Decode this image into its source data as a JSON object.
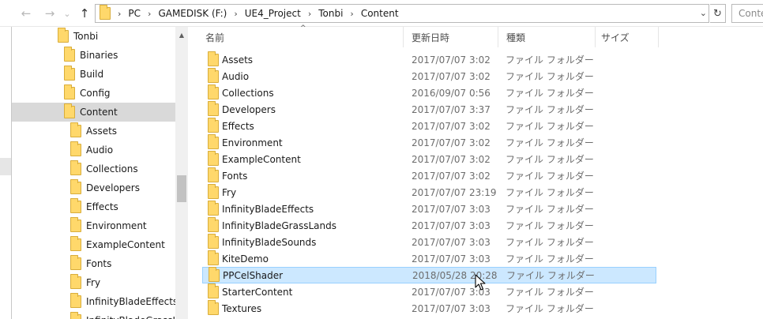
{
  "nav": {
    "back_glyph": "←",
    "forward_glyph": "→",
    "recent_glyph": "⌄",
    "up_glyph": "↑"
  },
  "address": {
    "crumbs": [
      "PC",
      "GAMEDISK (F:)",
      "UE4_Project",
      "Tonbi",
      "Content"
    ],
    "sep_glyph": "›",
    "dropdown_glyph": "⌄",
    "refresh_glyph": "↻"
  },
  "search": {
    "placeholder": "Conte"
  },
  "tree": {
    "items": [
      {
        "label": "Tonbi"
      },
      {
        "label": "Binaries"
      },
      {
        "label": "Build"
      },
      {
        "label": "Config"
      },
      {
        "label": "Content"
      },
      {
        "label": "Assets"
      },
      {
        "label": "Audio"
      },
      {
        "label": "Collections"
      },
      {
        "label": "Developers"
      },
      {
        "label": "Effects"
      },
      {
        "label": "Environment"
      },
      {
        "label": "ExampleContent"
      },
      {
        "label": "Fonts"
      },
      {
        "label": "Fry"
      },
      {
        "label": "InfinityBladeEffects"
      },
      {
        "label": "InfinityBladeGrassLands"
      }
    ],
    "selected_label": "Content"
  },
  "columns": {
    "name": "名前",
    "date": "更新日時",
    "type": "種類",
    "size": "サイズ",
    "sort_glyph": "^"
  },
  "files": [
    {
      "name": "Assets",
      "date": "2017/07/07 3:02",
      "type": "ファイル フォルダー"
    },
    {
      "name": "Audio",
      "date": "2017/07/07 3:02",
      "type": "ファイル フォルダー"
    },
    {
      "name": "Collections",
      "date": "2016/09/07 0:56",
      "type": "ファイル フォルダー"
    },
    {
      "name": "Developers",
      "date": "2017/07/07 3:37",
      "type": "ファイル フォルダー"
    },
    {
      "name": "Effects",
      "date": "2017/07/07 3:02",
      "type": "ファイル フォルダー"
    },
    {
      "name": "Environment",
      "date": "2017/07/07 3:02",
      "type": "ファイル フォルダー"
    },
    {
      "name": "ExampleContent",
      "date": "2017/07/07 3:02",
      "type": "ファイル フォルダー"
    },
    {
      "name": "Fonts",
      "date": "2017/07/07 3:02",
      "type": "ファイル フォルダー"
    },
    {
      "name": "Fry",
      "date": "2017/07/07 23:19",
      "type": "ファイル フォルダー"
    },
    {
      "name": "InfinityBladeEffects",
      "date": "2017/07/07 3:03",
      "type": "ファイル フォルダー"
    },
    {
      "name": "InfinityBladeGrassLands",
      "date": "2017/07/07 3:03",
      "type": "ファイル フォルダー"
    },
    {
      "name": "InfinityBladeSounds",
      "date": "2017/07/07 3:03",
      "type": "ファイル フォルダー"
    },
    {
      "name": "KiteDemo",
      "date": "2017/07/07 3:03",
      "type": "ファイル フォルダー"
    },
    {
      "name": "PPCelShader",
      "date": "2018/05/28 20:28",
      "type": "ファイル フォルダー"
    },
    {
      "name": "StarterContent",
      "date": "2017/07/07 3:03",
      "type": "ファイル フォルダー"
    },
    {
      "name": "Textures",
      "date": "2017/07/07 3:03",
      "type": "ファイル フォルダー"
    }
  ],
  "selected_file": "PPCelShader",
  "colors": {
    "selection_bg": "#cce8ff",
    "selection_border": "#99d1ff",
    "tree_selected_bg": "#d9d9d9",
    "folder_yellow": "#ffd86b"
  }
}
